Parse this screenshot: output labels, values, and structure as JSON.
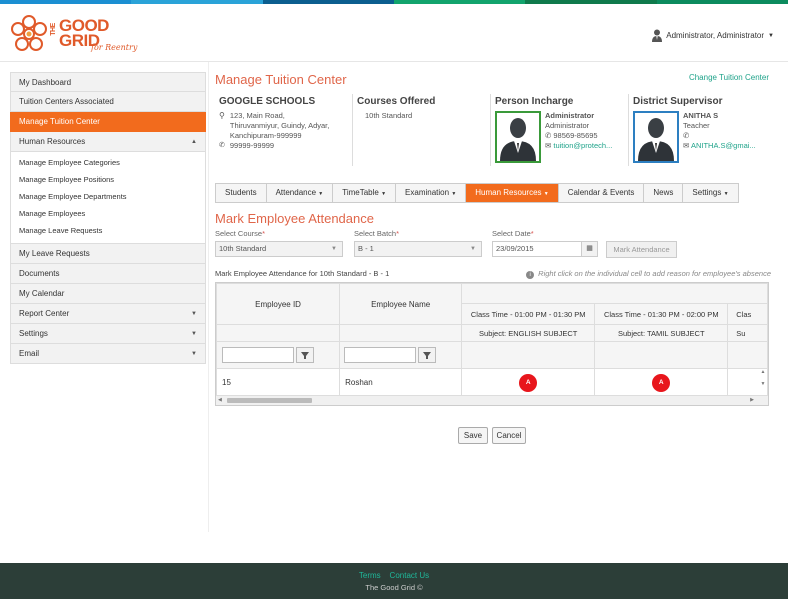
{
  "topbar_colors": [
    "#1b8fd2",
    "#2aa3d8",
    "#0c5e8f",
    "#12a46d",
    "#0f7a4c",
    "#0c8b5e"
  ],
  "header": {
    "logo_the": "THE",
    "logo_good": "GOOD",
    "logo_grid": "GRID",
    "logo_tagline": "for Reentry",
    "user_label": "Administrator, Administrator"
  },
  "sidebar": {
    "items": [
      {
        "label": "My Dashboard"
      },
      {
        "label": "Tuition Centers Associated"
      },
      {
        "label": "Manage Tuition Center",
        "active": true
      },
      {
        "label": "Human Resources",
        "expanded": true
      }
    ],
    "hr_subitems": [
      "Manage Employee Categories",
      "Manage Employee Positions",
      "Manage Employee Departments",
      "Manage Employees",
      "Manage Leave Requests"
    ],
    "bottom_items": [
      {
        "label": "My Leave Requests"
      },
      {
        "label": "Documents"
      },
      {
        "label": "My Calendar"
      },
      {
        "label": "Report Center"
      },
      {
        "label": "Settings"
      },
      {
        "label": "Email"
      }
    ]
  },
  "main": {
    "title": "Manage Tuition Center",
    "change_link": "Change Tuition Center",
    "school": {
      "name": "GOOGLE SCHOOLS",
      "address_1": "123, Main Road,",
      "address_2": "Thiruvanmiyur, Guindy, Adyar,",
      "address_3": "Kanchipuram-999999",
      "phone": "99999-99999"
    },
    "courses": {
      "heading": "Courses Offered",
      "value": "10th Standard"
    },
    "person_incharge": {
      "heading": "Person Incharge",
      "name": "Administrator",
      "role": "Administrator",
      "phone": "98569-85695",
      "email": "tuition@protech..."
    },
    "district_supervisor": {
      "heading": "District Supervisor",
      "name": "ANITHA S",
      "role": "Teacher",
      "phone": "",
      "email": "ANITHA.S@gmai..."
    },
    "nav": [
      {
        "label": "Students",
        "caret": false
      },
      {
        "label": "Attendance",
        "caret": true
      },
      {
        "label": "TimeTable",
        "caret": true
      },
      {
        "label": "Examination",
        "caret": true
      },
      {
        "label": "Human Resources",
        "caret": true,
        "active": true
      },
      {
        "label": "Calendar & Events",
        "caret": false
      },
      {
        "label": "News",
        "caret": false
      },
      {
        "label": "Settings",
        "caret": true
      }
    ],
    "attendance": {
      "title": "Mark Employee Attendance",
      "course_label": "Select Course",
      "course_value": "10th Standard",
      "batch_label": "Select Batch",
      "batch_value": "B - 1",
      "date_label": "Select Date",
      "date_value": "23/09/2015",
      "mark_button": "Mark Attendance",
      "for_label": "Mark Employee Attendance for  10th Standard - B - 1",
      "note": "Right click on the individual cell to add reason for employee's absence"
    },
    "grid": {
      "col_employee_id": "Employee ID",
      "col_employee_name": "Employee Name",
      "class_1_time": "Class Time - 01:00 PM - 01:30 PM",
      "class_1_subject": "Subject:  ENGLISH SUBJECT",
      "class_2_time": "Class Time - 01:30 PM - 02:00 PM",
      "class_2_subject": "Subject:  TAMIL SUBJECT",
      "class_3_time_partial": "Clas",
      "class_3_subject_partial": "Su",
      "rows": [
        {
          "id": "15",
          "name": "Roshan",
          "class_1": "A",
          "class_2": "A"
        }
      ]
    },
    "save_button": "Save",
    "cancel_button": "Cancel"
  },
  "footer": {
    "terms": "Terms",
    "contact": "Contact Us",
    "copyright": "The Good Grid ©"
  }
}
